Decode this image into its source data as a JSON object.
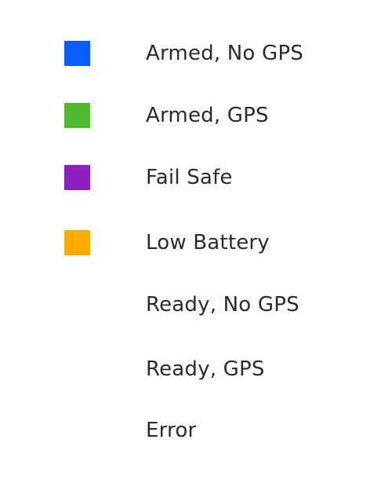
{
  "legend": {
    "items": [
      {
        "label": "Armed, No GPS",
        "color": "#0a5cff",
        "icon": "blue-square-icon"
      },
      {
        "label": "Armed, GPS",
        "color": "#4fb92f",
        "icon": "green-square-icon"
      },
      {
        "label": "Fail Safe",
        "color": "#8c1fbd",
        "icon": "purple-square-icon"
      },
      {
        "label": "Low Battery",
        "color": "#ffaa00",
        "icon": "orange-square-icon"
      },
      {
        "label": "Ready, No GPS",
        "color": null,
        "icon": null
      },
      {
        "label": "Ready, GPS",
        "color": null,
        "icon": null
      },
      {
        "label": "Error",
        "color": null,
        "icon": null
      }
    ]
  }
}
